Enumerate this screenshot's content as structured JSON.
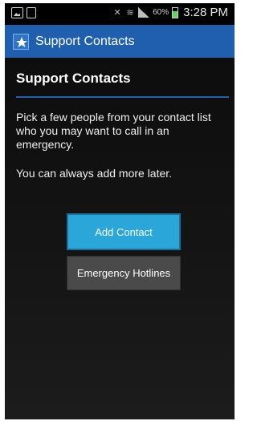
{
  "status_bar": {
    "battery_percent": "60%",
    "time": "3:28 PM",
    "icons": [
      "gallery-icon",
      "document-icon",
      "mute-icon",
      "wifi-icon",
      "signal-icon",
      "battery-icon"
    ]
  },
  "action_bar": {
    "title": "Support Contacts",
    "app_icon": "star-shield-icon",
    "color": "#1f5fae"
  },
  "main": {
    "heading": "Support Contacts",
    "description": "Pick a few people from your contact list who you may want to call in an emergency.",
    "note": "You can always add more later.",
    "add_contact_label": "Add Contact",
    "hotlines_label": "Emergency Hotlines",
    "accent_color": "#2aa7d8"
  }
}
